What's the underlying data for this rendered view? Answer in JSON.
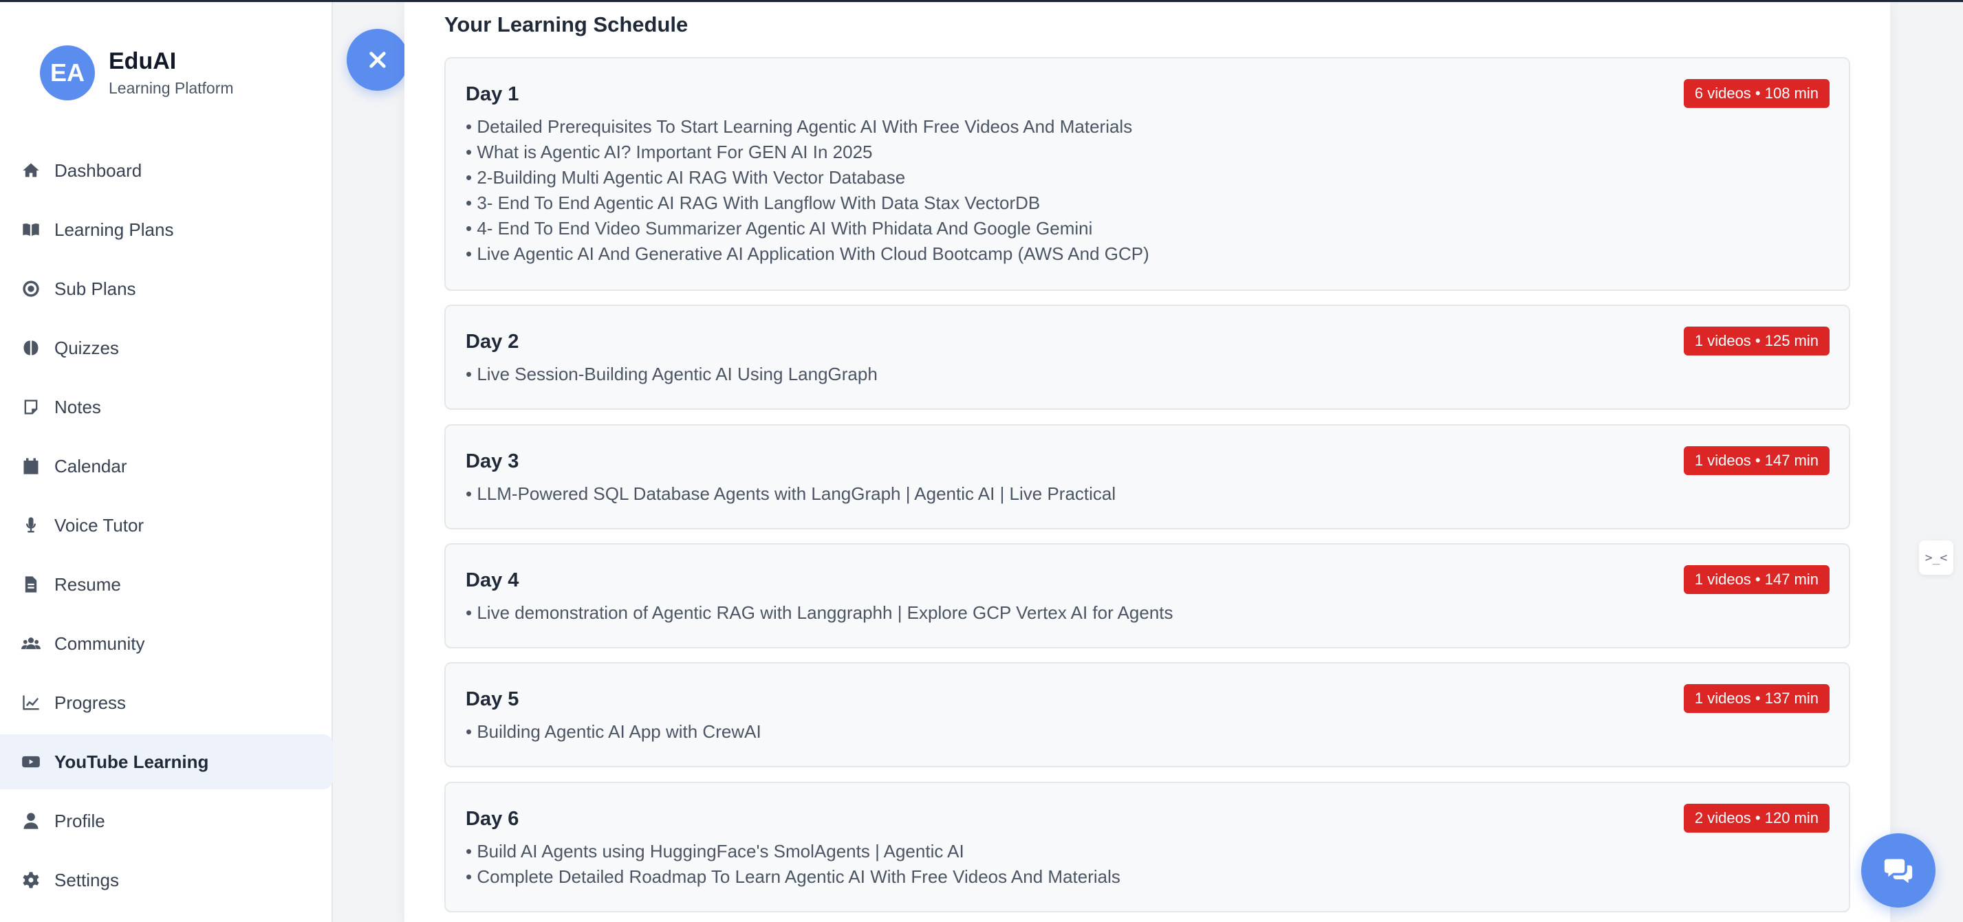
{
  "brand": {
    "initials": "EA",
    "name": "EduAI",
    "subtitle": "Learning Platform"
  },
  "sidebar": {
    "items": [
      {
        "label": "Dashboard",
        "icon": "home-icon"
      },
      {
        "label": "Learning Plans",
        "icon": "book-icon"
      },
      {
        "label": "Sub Plans",
        "icon": "target-icon"
      },
      {
        "label": "Quizzes",
        "icon": "brain-icon"
      },
      {
        "label": "Notes",
        "icon": "note-icon"
      },
      {
        "label": "Calendar",
        "icon": "calendar-icon"
      },
      {
        "label": "Voice Tutor",
        "icon": "microphone-icon"
      },
      {
        "label": "Resume",
        "icon": "file-icon"
      },
      {
        "label": "Community",
        "icon": "users-icon"
      },
      {
        "label": "Progress",
        "icon": "chart-line-icon"
      },
      {
        "label": "YouTube Learning",
        "icon": "youtube-icon",
        "active": true
      },
      {
        "label": "Profile",
        "icon": "user-icon"
      },
      {
        "label": "Settings",
        "icon": "gear-icon"
      }
    ]
  },
  "schedule": {
    "title": "Your Learning Schedule",
    "days": [
      {
        "title": "Day 1",
        "badge": "6 videos • 108 min",
        "videos": [
          "• Detailed Prerequisites To Start Learning Agentic AI With Free Videos And Materials",
          "• What is Agentic AI? Important For GEN AI In 2025",
          "• 2-Building Multi Agentic AI RAG With Vector Database",
          "• 3- End To End Agentic AI RAG With Langflow With Data Stax VectorDB",
          "• 4- End To End Video Summarizer Agentic AI With Phidata And Google Gemini",
          "• Live Agentic AI And Generative AI Application With Cloud Bootcamp (AWS And GCP)"
        ]
      },
      {
        "title": "Day 2",
        "badge": "1 videos • 125 min",
        "videos": [
          "• Live Session-Building Agentic AI Using LangGraph"
        ]
      },
      {
        "title": "Day 3",
        "badge": "1 videos • 147 min",
        "videos": [
          "• LLM-Powered SQL Database Agents with LangGraph | Agentic AI | Live Practical"
        ]
      },
      {
        "title": "Day 4",
        "badge": "1 videos • 147 min",
        "videos": [
          "• Live demonstration of Agentic RAG with Langgraphh | Explore GCP Vertex AI for Agents"
        ]
      },
      {
        "title": "Day 5",
        "badge": "1 videos • 137 min",
        "videos": [
          "• Building Agentic AI App with CrewAI"
        ]
      },
      {
        "title": "Day 6",
        "badge": "2 videos • 120 min",
        "videos": [
          "• Build AI Agents using HuggingFace's SmolAgents | Agentic AI",
          "• Complete Detailed Roadmap To Learn Agentic AI With Free Videos And Materials"
        ]
      }
    ]
  },
  "widgets": {
    "edge_widget_text": ">_<",
    "close_icon": "close-icon",
    "chat_icon": "chat-icon"
  },
  "colors": {
    "accent": "#5b8def",
    "badge": "#dc2626",
    "active_nav_bg": "#eef3fb"
  }
}
